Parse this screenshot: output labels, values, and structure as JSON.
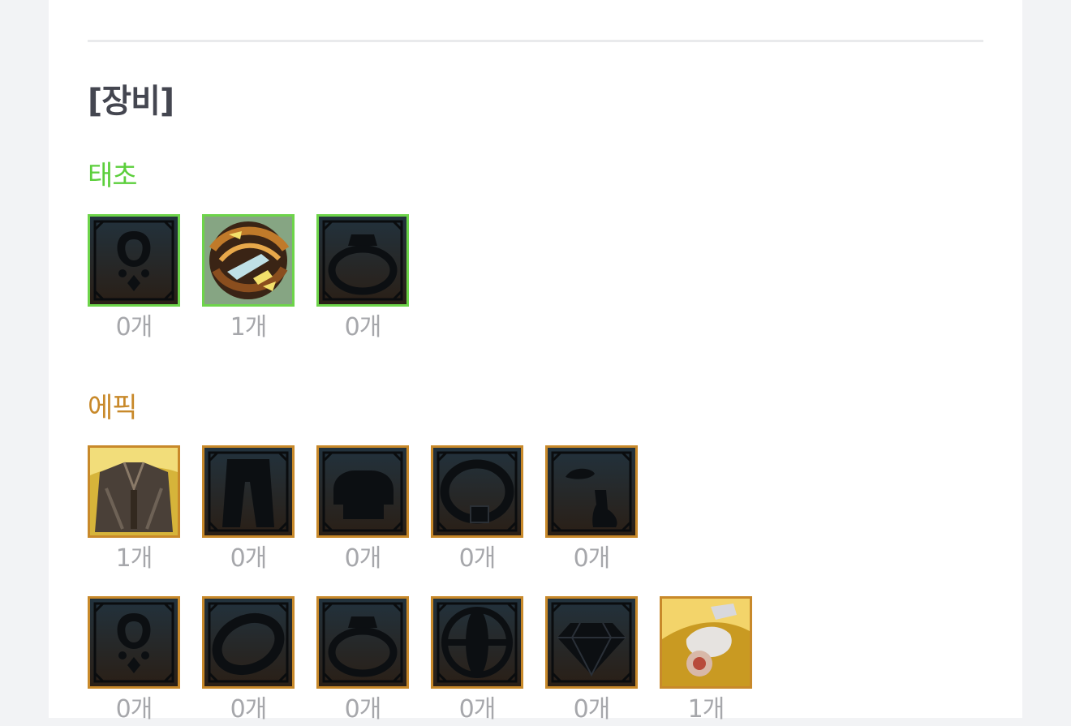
{
  "section": {
    "title": "[장비]"
  },
  "colors": {
    "taecho": "#5ccf3c",
    "epic": "#c8892a",
    "count": "#a6a7ab",
    "title": "#444650"
  },
  "groups": [
    {
      "name": "태초",
      "rows": [
        [
          {
            "icon": "necklace-icon",
            "count": "0개",
            "filled": false
          },
          {
            "icon": "bracelet-icon",
            "count": "1개",
            "filled": true
          },
          {
            "icon": "ring-icon",
            "count": "0개",
            "filled": false
          }
        ]
      ]
    },
    {
      "name": "에픽",
      "rows": [
        [
          {
            "icon": "top-armor-icon",
            "count": "1개",
            "filled": true
          },
          {
            "icon": "pants-icon",
            "count": "0개",
            "filled": false
          },
          {
            "icon": "shoulder-icon",
            "count": "0개",
            "filled": false
          },
          {
            "icon": "belt-icon",
            "count": "0개",
            "filled": false
          },
          {
            "icon": "shoes-icon",
            "count": "0개",
            "filled": false
          }
        ],
        [
          {
            "icon": "necklace-icon",
            "count": "0개",
            "filled": false
          },
          {
            "icon": "bracelet-icon",
            "count": "0개",
            "filled": false
          },
          {
            "icon": "ring-icon",
            "count": "0개",
            "filled": false
          },
          {
            "icon": "support-icon",
            "count": "0개",
            "filled": false
          },
          {
            "icon": "gem-icon",
            "count": "0개",
            "filled": false
          },
          {
            "icon": "earring-icon",
            "count": "1개",
            "filled": true
          }
        ]
      ]
    }
  ]
}
